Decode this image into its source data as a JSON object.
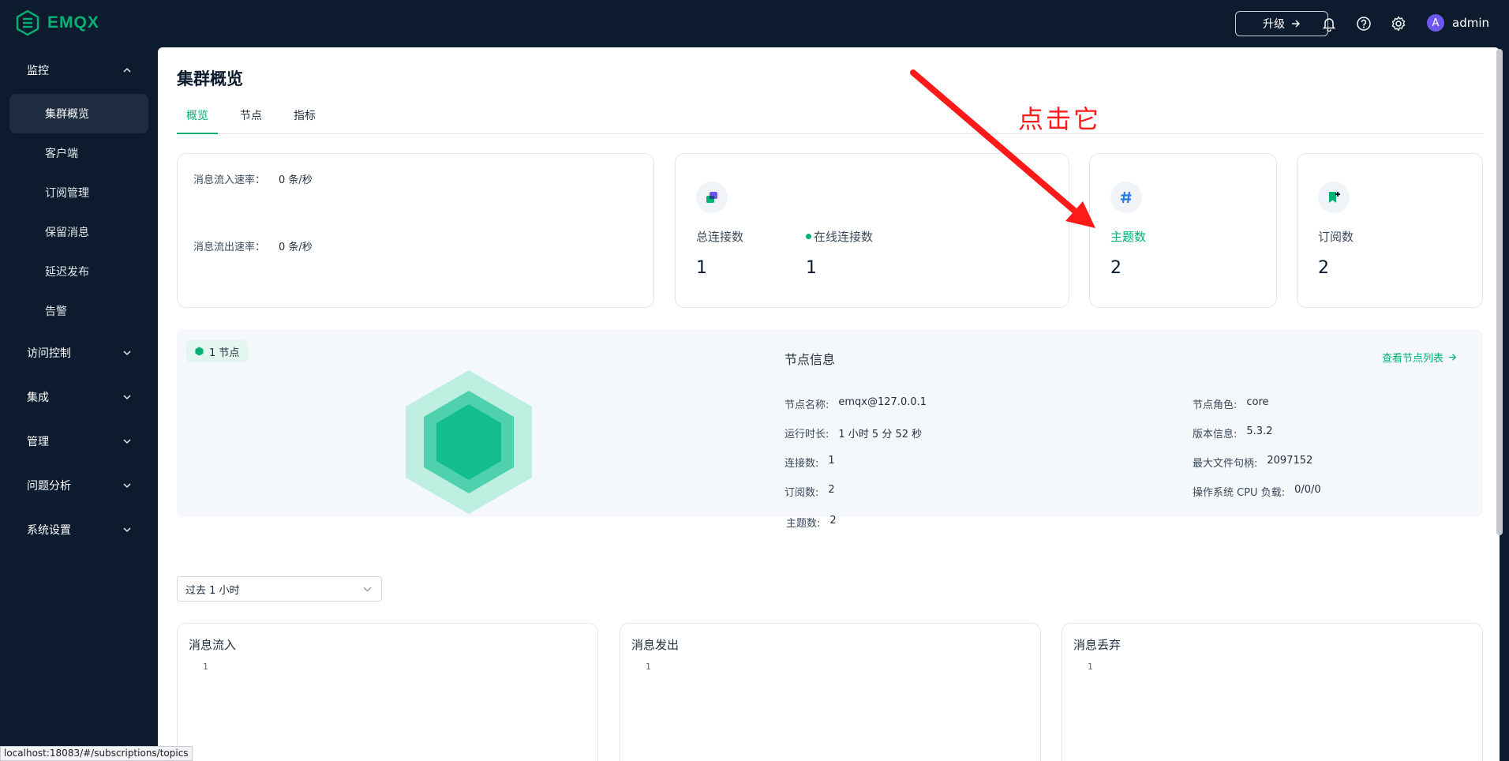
{
  "app": {
    "name": "EMQX"
  },
  "topbar": {
    "upgrade_label": "升级",
    "user_initial": "A",
    "user_name": "admin"
  },
  "sidebar": {
    "monitor": {
      "label": "监控",
      "items": [
        "集群概览",
        "客户端",
        "订阅管理",
        "保留消息",
        "延迟发布",
        "告警"
      ]
    },
    "groups": [
      "访问控制",
      "集成",
      "管理",
      "问题分析",
      "系统设置"
    ]
  },
  "page": {
    "title": "集群概览",
    "tabs": [
      "概览",
      "节点",
      "指标"
    ]
  },
  "rates": {
    "in_label": "消息流入速率：",
    "in_value": "0 条/秒",
    "out_label": "消息流出速率：",
    "out_value": "0 条/秒"
  },
  "stats": {
    "total_conn_label": "总连接数",
    "total_conn_value": "1",
    "online_conn_label": "在线连接数",
    "online_conn_value": "1",
    "topics_label": "主题数",
    "topics_value": "2",
    "subs_label": "订阅数",
    "subs_value": "2"
  },
  "node": {
    "badge": "1 节点",
    "info_title": "节点信息",
    "list_link": "查看节点列表",
    "left": [
      {
        "k": "节点名称:",
        "v": "emqx@127.0.0.1"
      },
      {
        "k": "运行时长:",
        "v": "1 小时 5 分 52 秒"
      },
      {
        "k": "连接数:",
        "v": "1"
      },
      {
        "k": "订阅数:",
        "v": "2"
      },
      {
        "k": "主题数:",
        "v": "2"
      }
    ],
    "right": [
      {
        "k": "节点角色:",
        "v": "core"
      },
      {
        "k": "版本信息:",
        "v": "5.3.2"
      },
      {
        "k": "最大文件句柄:",
        "v": "2097152"
      },
      {
        "k": "操作系统 CPU 负载:",
        "v": "0/0/0"
      }
    ]
  },
  "time_range": {
    "selected": "过去 1 小时"
  },
  "charts": [
    {
      "title": "消息流入",
      "tick": "1"
    },
    {
      "title": "消息发出",
      "tick": "1"
    },
    {
      "title": "消息丢弃",
      "tick": "1"
    }
  ],
  "annotation": {
    "text": "点击它"
  },
  "status_bar": {
    "url": "localhost:18083/#/subscriptions/topics"
  },
  "colors": {
    "accent": "#00b173",
    "sidebar_bg": "#0c1c2e",
    "annotation": "#ff1a1a"
  }
}
